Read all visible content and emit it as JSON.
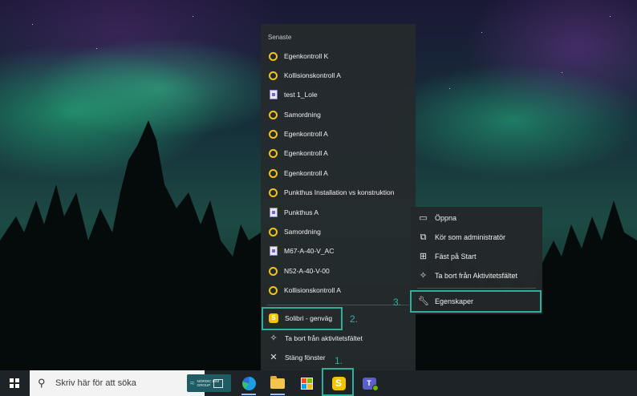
{
  "jump_list": {
    "header": "Senaste",
    "recent": [
      {
        "label": "Egenkontroll K",
        "icon": "solibri-ring-icon"
      },
      {
        "label": "Kollisionskontroll A",
        "icon": "solibri-ring-icon"
      },
      {
        "label": "test 1_Lole",
        "icon": "document-icon"
      },
      {
        "label": "Samordning",
        "icon": "solibri-ring-icon"
      },
      {
        "label": "Egenkontroll A",
        "icon": "solibri-ring-icon"
      },
      {
        "label": "Egenkontroll A",
        "icon": "solibri-ring-icon"
      },
      {
        "label": "Egenkontroll A",
        "icon": "solibri-ring-icon"
      },
      {
        "label": "Punkthus Installation vs konstruktion",
        "icon": "solibri-ring-icon"
      },
      {
        "label": "Punkthus A",
        "icon": "document-icon"
      },
      {
        "label": "Samordning",
        "icon": "solibri-ring-icon"
      },
      {
        "label": "M67-A-40-V_AC",
        "icon": "document-icon"
      },
      {
        "label": "N52-A-40-V-00",
        "icon": "solibri-ring-icon"
      },
      {
        "label": "Kollisionskontroll A",
        "icon": "solibri-ring-icon"
      }
    ],
    "app_shortcut": {
      "label": "Solibri - genväg",
      "badge": "S"
    },
    "unpin": "Ta bort från aktivitetsfältet",
    "close": "Stäng fönster"
  },
  "context_menu": {
    "items": [
      "Öppna",
      "Kör som administratör",
      "Fäst på Start",
      "Ta bort från Aktivitetsfältet"
    ],
    "properties": "Egenskaper"
  },
  "steps": {
    "one": "1.",
    "two": "2.",
    "three": "3."
  },
  "taskbar": {
    "search_placeholder": "Skriv här för att söka",
    "nordic_line1": "NORDIC BIM",
    "nordic_line2": "GROUP",
    "solibri_letter": "S",
    "teams_letter": "T"
  },
  "colors": {
    "highlight": "#2fae9a",
    "solibri_yellow": "#f5c400",
    "menu_bg": "#262a2c"
  }
}
